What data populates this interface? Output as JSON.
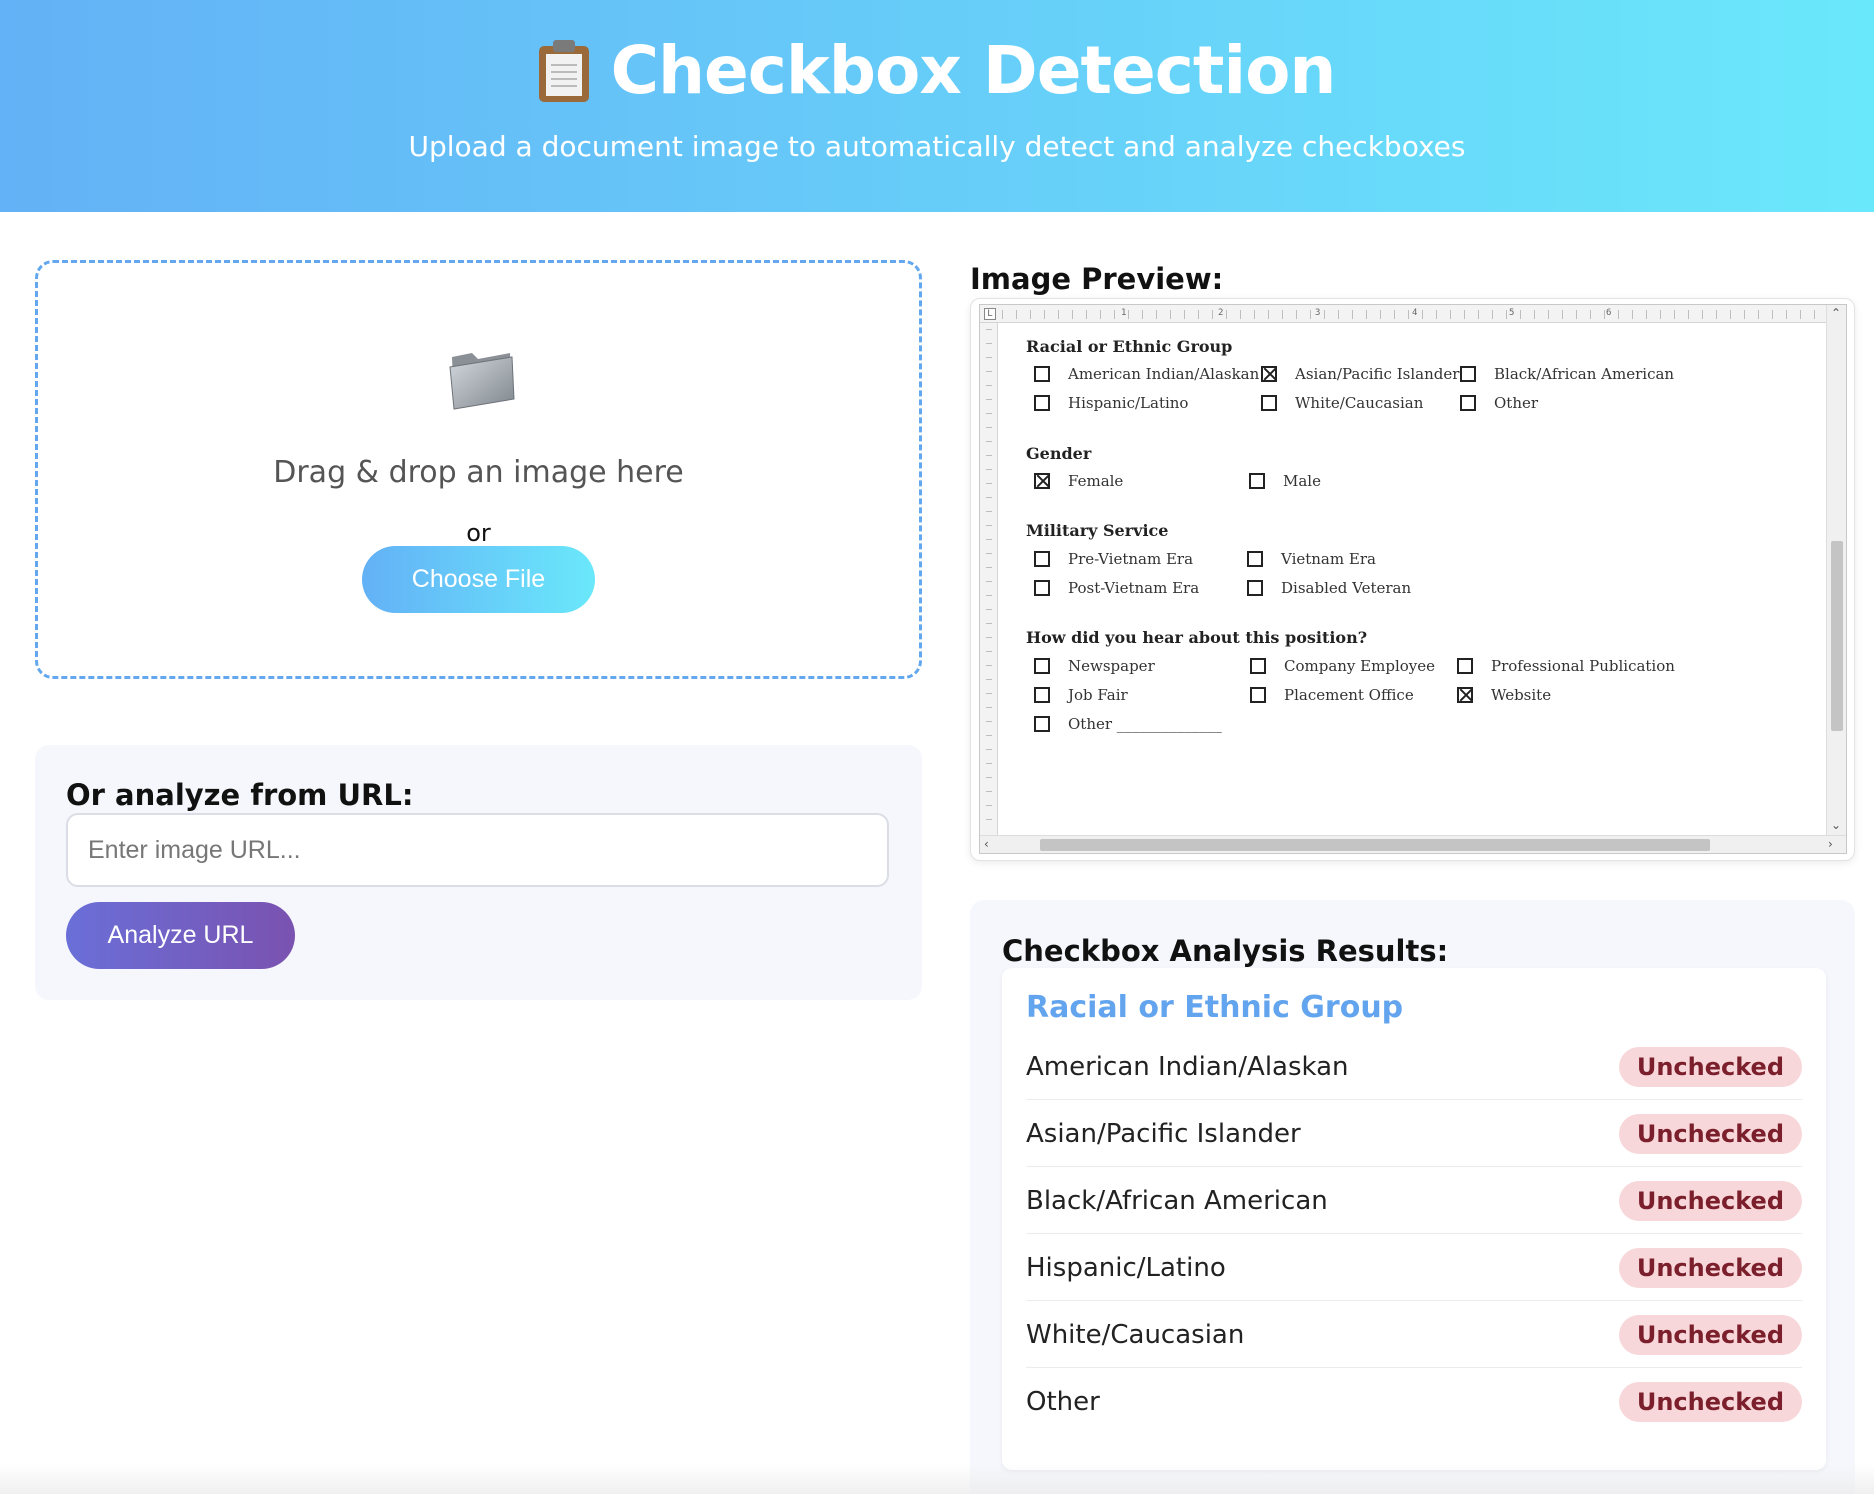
{
  "header": {
    "title": "Checkbox Detection",
    "subtitle": "Upload a document image to automatically detect and analyze checkboxes",
    "icon": "clipboard-icon",
    "gradient": [
      "#63b1f6",
      "#6ae8fb"
    ]
  },
  "upload": {
    "icon": "folder-icon",
    "drag_text": "Drag & drop an image here",
    "or_text": "or",
    "choose_label": "Choose File"
  },
  "url": {
    "heading": "Or analyze from URL:",
    "placeholder": "Enter image URL...",
    "value": "",
    "button_label": "Analyze URL"
  },
  "preview": {
    "heading": "Image Preview:",
    "ruler_numbers": [
      "1",
      "2",
      "3",
      "4",
      "5",
      "6"
    ],
    "document": {
      "sections": [
        {
          "title": "Racial or Ethnic Group",
          "options": [
            {
              "label": "American Indian/Alaskan",
              "checked": false
            },
            {
              "label": "Asian/Pacific Islander",
              "checked": true
            },
            {
              "label": "Black/African American",
              "checked": false
            },
            {
              "label": "Hispanic/Latino",
              "checked": false
            },
            {
              "label": "White/Caucasian",
              "checked": false
            },
            {
              "label": "Other",
              "checked": false
            }
          ]
        },
        {
          "title": "Gender",
          "options": [
            {
              "label": "Female",
              "checked": true
            },
            {
              "label": "Male",
              "checked": false
            }
          ]
        },
        {
          "title": "Military Service",
          "options": [
            {
              "label": "Pre-Vietnam Era",
              "checked": false
            },
            {
              "label": "Vietnam Era",
              "checked": false
            },
            {
              "label": "Post-Vietnam Era",
              "checked": false
            },
            {
              "label": "Disabled Veteran",
              "checked": false
            }
          ]
        },
        {
          "title": "How did you hear about this position?",
          "options": [
            {
              "label": "Newspaper",
              "checked": false
            },
            {
              "label": "Company Employee",
              "checked": false
            },
            {
              "label": "Professional Publication",
              "checked": false
            },
            {
              "label": "Job Fair",
              "checked": false
            },
            {
              "label": "Placement Office",
              "checked": false
            },
            {
              "label": "Website",
              "checked": true
            },
            {
              "label": "Other ______________",
              "checked": false
            }
          ]
        }
      ]
    }
  },
  "results": {
    "heading": "Checkbox Analysis Results:",
    "group_title": "Racial or Ethnic Group",
    "items": [
      {
        "label": "American Indian/Alaskan",
        "status": "Unchecked"
      },
      {
        "label": "Asian/Pacific Islander",
        "status": "Unchecked"
      },
      {
        "label": "Black/African American",
        "status": "Unchecked"
      },
      {
        "label": "Hispanic/Latino",
        "status": "Unchecked"
      },
      {
        "label": "White/Caucasian",
        "status": "Unchecked"
      },
      {
        "label": "Other",
        "status": "Unchecked"
      }
    ],
    "badge_colors": {
      "background": "#f8d7da",
      "text": "#7a1f2b"
    },
    "group_color": "#63a4ee"
  }
}
